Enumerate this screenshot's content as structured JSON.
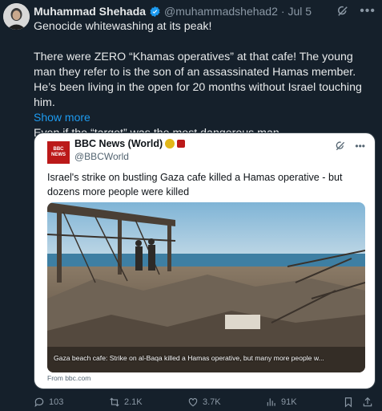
{
  "author": {
    "name": "Muhammad Shehada",
    "handle": "@muhammadshehad2",
    "date": "· Jul 5",
    "verified_color": "#1d9bf0"
  },
  "tweet": {
    "lines": [
      "Genocide whitewashing at its peak!",
      "There were ZERO “Khamas operatives” at that cafe! The young man they refer to is the son of an assassinated Hamas member. He’s been living in the open for 20 months without Israel touching him.",
      "Even if the “target” was the most dangerous man"
    ],
    "show_more": "Show more"
  },
  "quote": {
    "logo_text": "BBC NEWS",
    "name": "BBC News (World)",
    "handle": "@BBCWorld",
    "text": "Israel's strike on bustling Gaza cafe killed a Hamas operative - but dozens more people were killed",
    "image_caption": "Gaza beach cafe: Strike on al-Baqa killed a Hamas operative, but many more people w...",
    "from": "From bbc.com"
  },
  "actions": {
    "replies": "103",
    "reposts": "2.1K",
    "likes": "3.7K",
    "views": "91K"
  },
  "colors": {
    "background": "#15202b",
    "accent": "#1d9bf0",
    "bbc_red": "#bb1919"
  }
}
